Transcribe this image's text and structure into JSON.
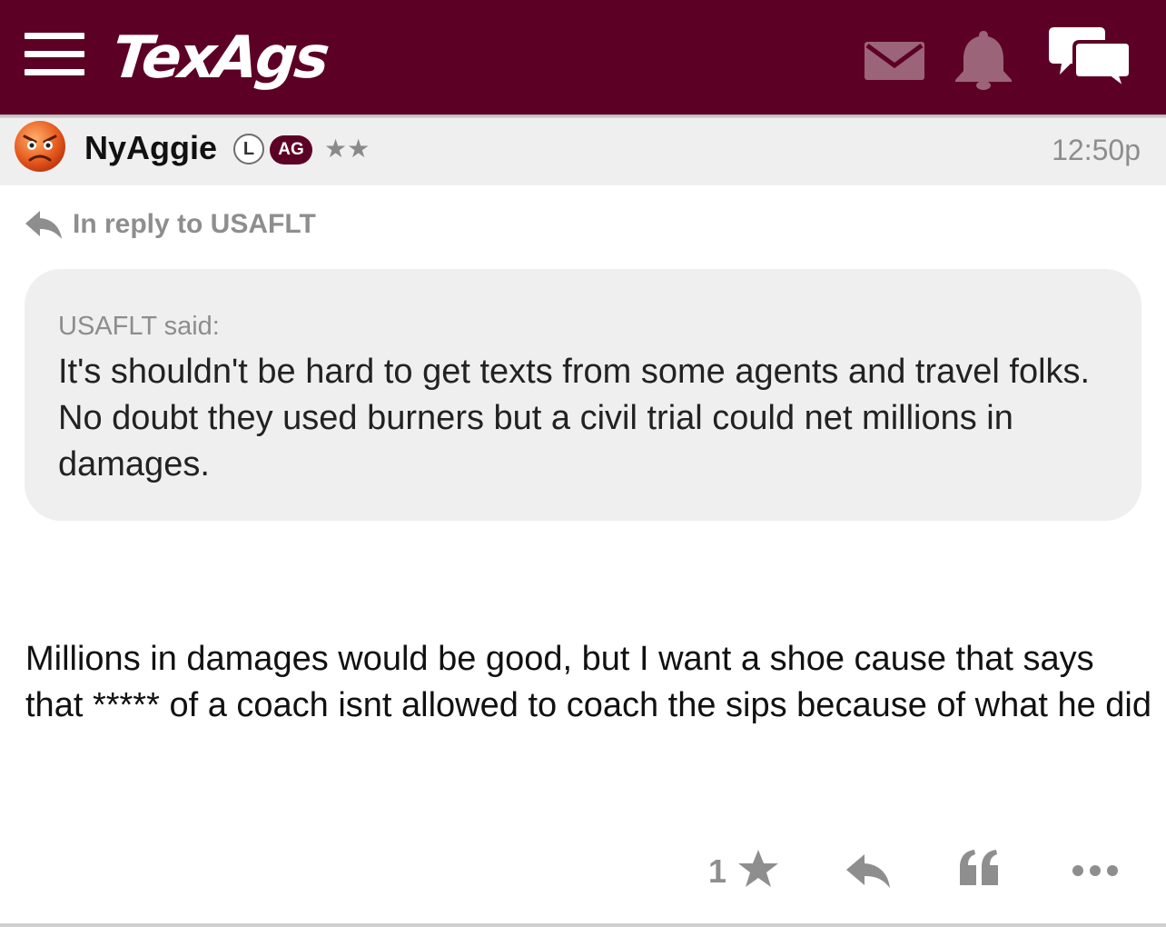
{
  "header": {
    "logo_text": "TexAgs",
    "brand_color": "#5d0025",
    "icons": [
      "hamburger-menu-icon",
      "mail-icon",
      "bell-icon",
      "chat-icon"
    ]
  },
  "post": {
    "username": "NyAggie",
    "badges": {
      "lifetime": "L",
      "ag": "AG"
    },
    "stars": "★★",
    "time": "12:50p",
    "reply_to": "In reply to USAFLT",
    "quote": {
      "author_line": "USAFLT said:",
      "text": "It's shouldn't be hard to get texts from some agents and travel folks. No doubt they used burners but a civil trial could net millions in damages."
    },
    "body": "Millions in damages would be good, but I want a shoe cause that says that ***** of a coach isnt allowed to coach the sips because of what he did"
  },
  "actions": {
    "like_count": "1"
  }
}
